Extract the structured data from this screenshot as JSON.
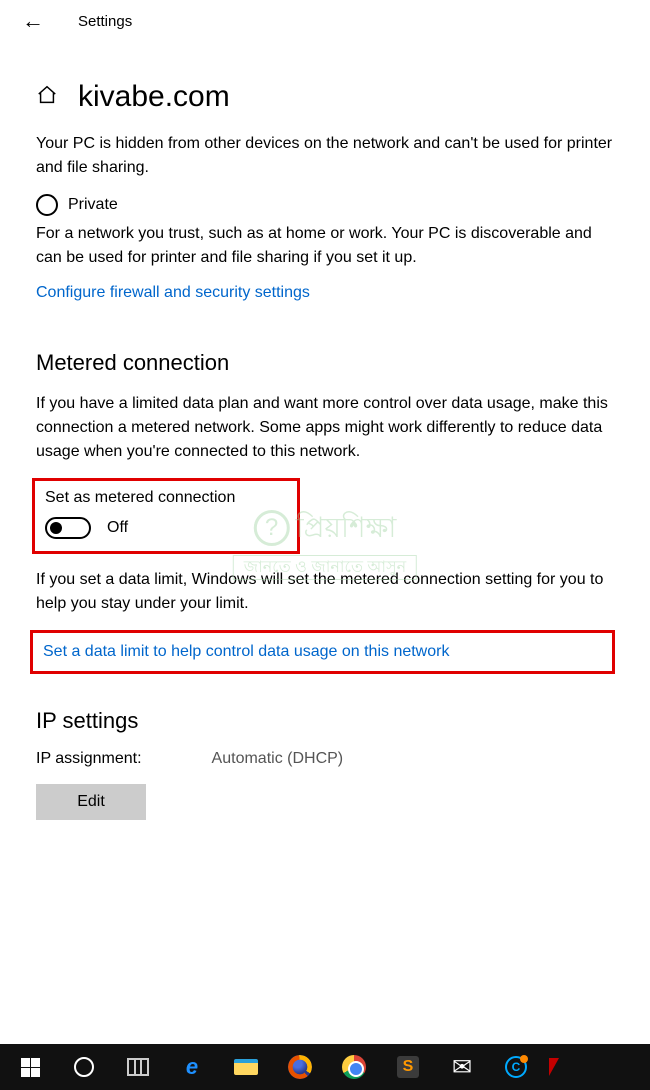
{
  "header": {
    "settings_label": "Settings"
  },
  "page": {
    "title": "kivabe.com",
    "hidden_text": "Your PC is hidden from other devices on the network and can't be used for printer and file sharing.",
    "private_label": "Private",
    "private_desc": "For a network you trust, such as at home or work. Your PC is discoverable and can be used for printer and file sharing if you set it up.",
    "firewall_link": "Configure firewall and security settings"
  },
  "metered": {
    "heading": "Metered connection",
    "desc": "If you have a limited data plan and want more control over data usage, make this connection a metered network. Some apps might work differently to reduce data usage when you're connected to this network.",
    "toggle_label": "Set as metered connection",
    "toggle_state": "Off",
    "limit_desc": "If you set a data limit, Windows will set the metered connection setting for you to help you stay under your limit.",
    "limit_link": "Set a data limit to help control data usage on this network"
  },
  "ip": {
    "heading": "IP settings",
    "assignment_label": "IP assignment:",
    "assignment_value": "Automatic (DHCP)",
    "edit_label": "Edit"
  },
  "watermark": {
    "main": "প্রিয়শিক্ষা",
    "sub": "জানতে ও জানাতে আসুন"
  },
  "colors": {
    "link": "#0066cc",
    "highlight": "#e00000"
  }
}
